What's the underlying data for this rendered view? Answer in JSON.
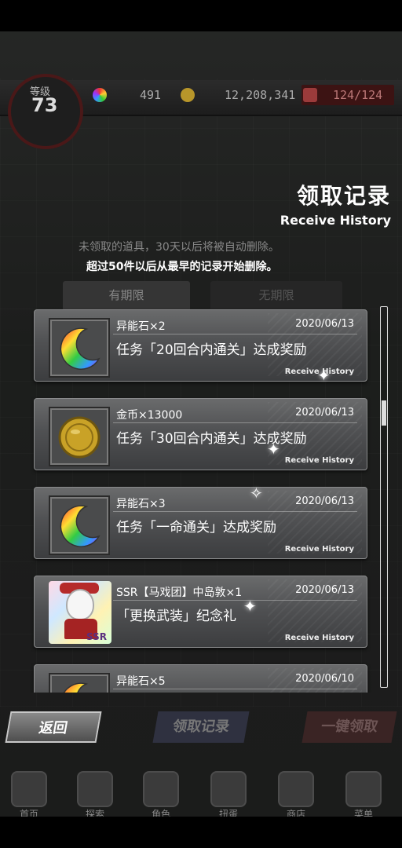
{
  "status": {
    "level_label": "等级",
    "level": "73",
    "stones": "491",
    "coins": "12,208,341",
    "stamina": "124/124"
  },
  "header": {
    "title": "领取记录",
    "subtitle": "Receive History",
    "note_dim": "未领取的道具，30天以后将被自动删除。",
    "note": "超过50件以后从最早的记录开始删除。"
  },
  "tabs": [
    {
      "label": "有期限"
    },
    {
      "label": "无期限"
    }
  ],
  "items": [
    {
      "name": "异能石×2",
      "date": "2020/06/13",
      "desc": "任务「20回合内通关」达成奖励",
      "tag": "Receive History",
      "icon": "moon-stone-icon"
    },
    {
      "name": "金币×13000",
      "date": "2020/06/13",
      "desc": "任务「30回合内通关」达成奖励",
      "tag": "Receive History",
      "icon": "gold-coin-icon"
    },
    {
      "name": "异能石×3",
      "date": "2020/06/13",
      "desc": "任务「一命通关」达成奖励",
      "tag": "Receive History",
      "icon": "moon-stone-icon"
    },
    {
      "name": "SSR【马戏团】中岛敦×1",
      "date": "2020/06/13",
      "desc": "「更换武装」纪念礼",
      "tag": "Receive History",
      "icon": "ssr-card-icon",
      "badge": "SSR"
    },
    {
      "name": "异能石×5",
      "date": "2020/06/10",
      "desc": "",
      "tag": "",
      "icon": "moon-stone-icon"
    }
  ],
  "buttons": {
    "back": "返回",
    "history": "领取记录",
    "claim_all": "一键领取"
  },
  "nav": [
    {
      "label": "首页",
      "icon": "home-icon"
    },
    {
      "label": "探索",
      "icon": "explore-icon"
    },
    {
      "label": "角色",
      "icon": "characters-icon"
    },
    {
      "label": "扭蛋",
      "icon": "gacha-icon"
    },
    {
      "label": "商店",
      "icon": "shop-icon"
    },
    {
      "label": "菜单",
      "icon": "menu-gear-icon"
    }
  ],
  "colors": {
    "accent_red": "#b52a2a",
    "card_gray": "#505153",
    "gold": "#c9a227"
  }
}
